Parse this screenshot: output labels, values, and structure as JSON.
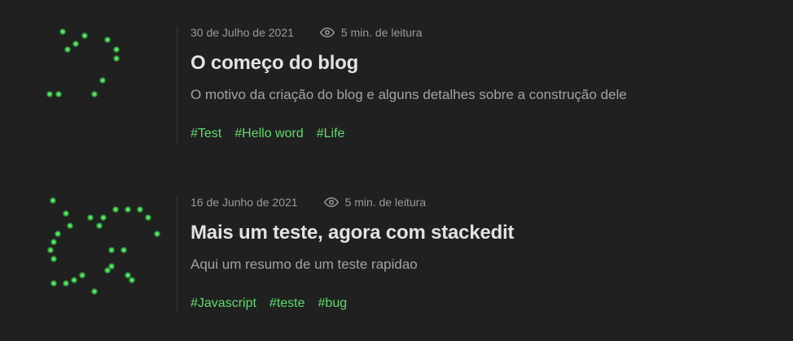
{
  "colors": {
    "background": "#202020",
    "accent": "#5fdc6b",
    "title": "#e2e2e2",
    "muted": "#9a9a9a"
  },
  "posts": [
    {
      "date": "30 de Julho de 2021",
      "read_time": "5 min. de leitura",
      "read_icon": "eye-icon",
      "title": "O começo do blog",
      "summary": "O motivo da criação do blog e alguns detalhes sobre a construção dele",
      "tags": [
        "#Test",
        "#Hello word",
        "#Life"
      ]
    },
    {
      "date": "16 de Junho de 2021",
      "read_time": "5 min. de leitura",
      "read_icon": "eye-icon",
      "title": "Mais um teste, agora com stackedit",
      "summary": "Aqui um resumo de um teste rapidao",
      "tags": [
        "#Javascript",
        "#teste",
        "#bug"
      ]
    }
  ]
}
